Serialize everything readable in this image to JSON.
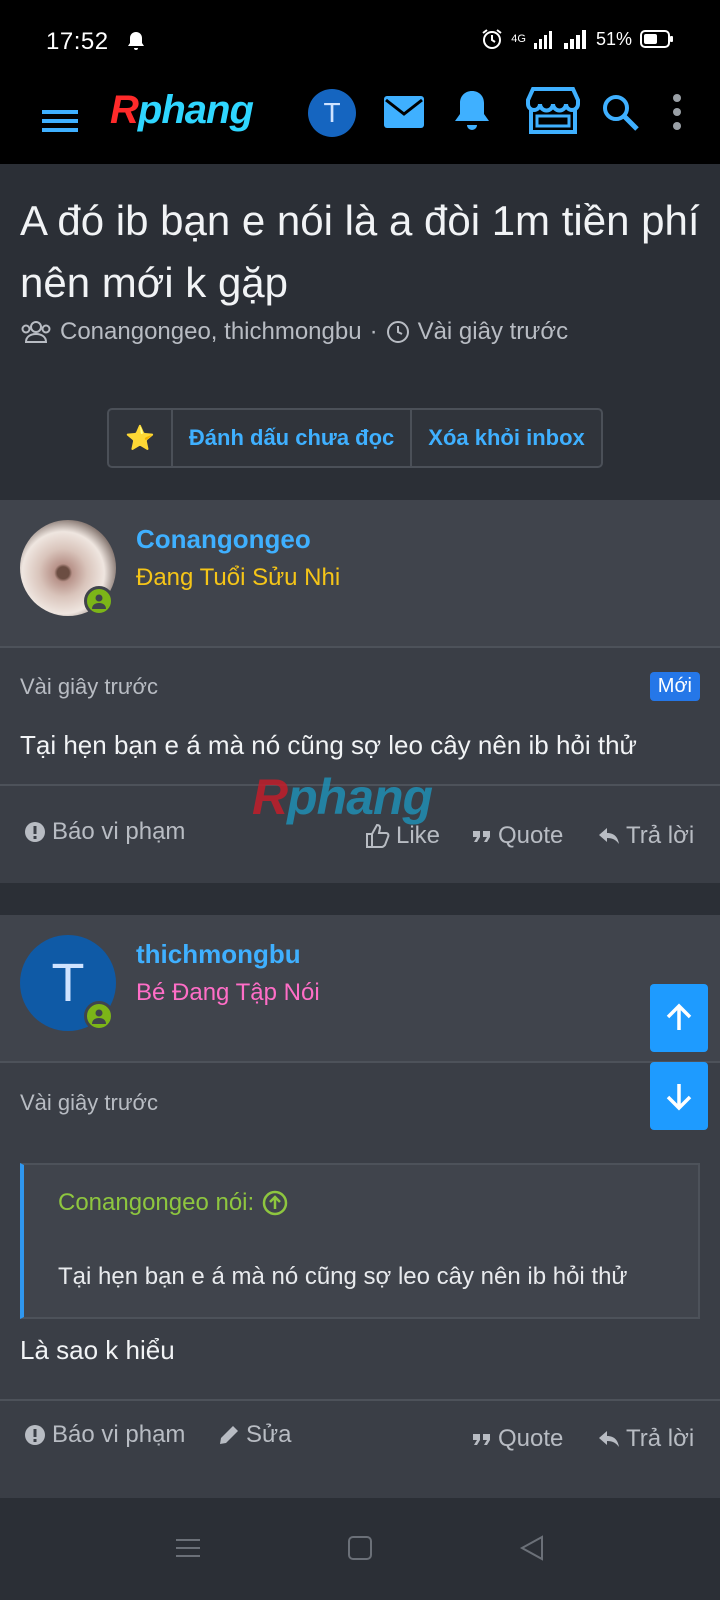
{
  "status_bar": {
    "time": "17:52",
    "network": "4G",
    "battery": "51%"
  },
  "app": {
    "logo_first": "R",
    "logo_rest": "phang",
    "avatar_letter": "T",
    "accent": "#3fb0ff"
  },
  "thread": {
    "title": "A đó ib bạn e nói là a đòi 1m tiền phí nên mới k gặp",
    "participants": "Conangongeo, thichmongbu",
    "separator": "·",
    "time": "Vài giây trước"
  },
  "actions": {
    "star": "⭐",
    "mark_unread": "Đánh dấu chưa đọc",
    "remove_inbox": "Xóa khỏi inbox"
  },
  "posts": [
    {
      "username": "Conangongeo",
      "user_title": "Đang Tuổi Sửu Nhi",
      "user_title_color": "#f5c518",
      "time": "Vài giây trước",
      "badge": "Mới",
      "text": "Tại hẹn bạn e á mà nó cũng sợ leo cây nên ib hỏi thử",
      "report": "Báo vi phạm",
      "like": "Like",
      "quote": "Quote",
      "reply": "Trả lời"
    },
    {
      "username": "thichmongbu",
      "avatar_letter": "T",
      "user_title": "Bé Đang Tập Nói",
      "user_title_color": "#ff6ec7",
      "time": "Vài giây trước",
      "quote_author": "Conangongeo nói:",
      "quote_text": "Tại hẹn bạn e á mà nó cũng sợ leo cây nên ib hỏi thử",
      "text": "Là sao k hiểu",
      "report": "Báo vi phạm",
      "edit": "Sửa",
      "quote": "Quote",
      "reply": "Trả lời"
    }
  ],
  "watermark": {
    "first": "R",
    "rest": "phang"
  }
}
